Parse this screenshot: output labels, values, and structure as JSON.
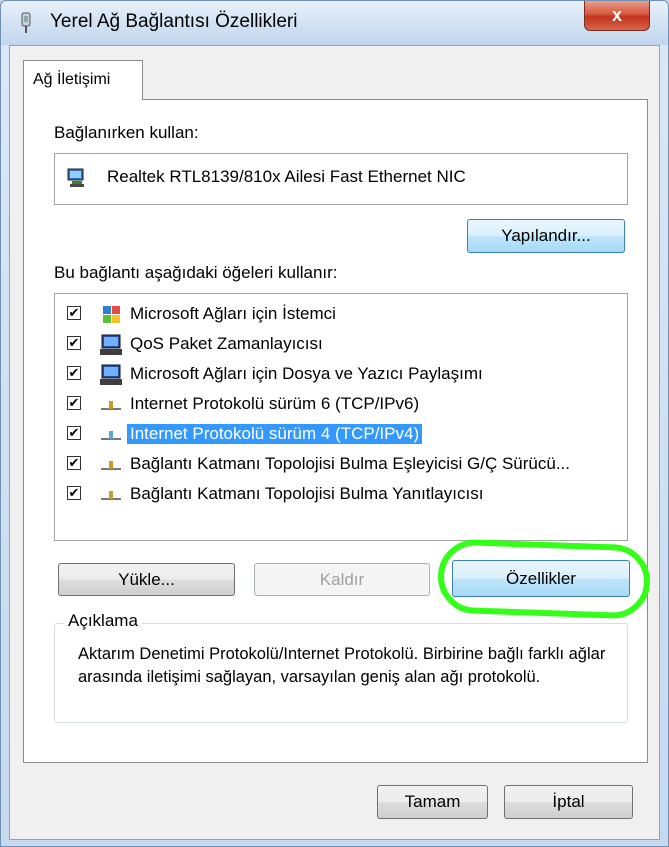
{
  "window": {
    "title": "Yerel Ağ Bağlantısı Özellikleri",
    "close_label": "x"
  },
  "tab": {
    "label": "Ağ İletişimi"
  },
  "connect_using": {
    "label": "Bağlanırken kullan:",
    "adapter_name": "Realtek RTL8139/810x Ailesi Fast Ethernet NIC",
    "configure_label": "Yapılandır..."
  },
  "items_section": {
    "label": "Bu bağlantı aşağıdaki öğeleri kullanır:",
    "items": [
      {
        "label": "Microsoft Ağları için İstemci",
        "checked": true,
        "icon": "network-client-icon",
        "selected": false
      },
      {
        "label": "QoS Paket Zamanlayıcısı",
        "checked": true,
        "icon": "network-service-icon",
        "selected": false
      },
      {
        "label": "Microsoft Ağları için Dosya ve Yazıcı Paylaşımı",
        "checked": true,
        "icon": "network-service-icon",
        "selected": false
      },
      {
        "label": "Internet Protokolü sürüm 6 (TCP/IPv6)",
        "checked": true,
        "icon": "protocol-icon",
        "selected": false
      },
      {
        "label": "Internet Protokolü sürüm 4 (TCP/IPv4)",
        "checked": true,
        "icon": "protocol-icon",
        "selected": true
      },
      {
        "label": "Bağlantı Katmanı Topolojisi Bulma Eşleyicisi G/Ç Sürücü...",
        "checked": true,
        "icon": "protocol-icon",
        "selected": false
      },
      {
        "label": "Bağlantı Katmanı Topolojisi Bulma Yanıtlayıcısı",
        "checked": true,
        "icon": "protocol-icon",
        "selected": false
      }
    ]
  },
  "buttons": {
    "install": "Yükle...",
    "uninstall": "Kaldır",
    "properties": "Özellikler",
    "ok": "Tamam",
    "cancel": "İptal"
  },
  "description": {
    "legend": "Açıklama",
    "text": "Aktarım Denetimi Protokolü/Internet Protokolü. Birbirine bağlı farklı ağlar arasında iletişimi sağlayan, varsayılan geniş alan ağı protokolü."
  },
  "colors": {
    "selection": "#3399ff",
    "annotation_oval": "#33ff19",
    "close_button": "#c8432a"
  }
}
